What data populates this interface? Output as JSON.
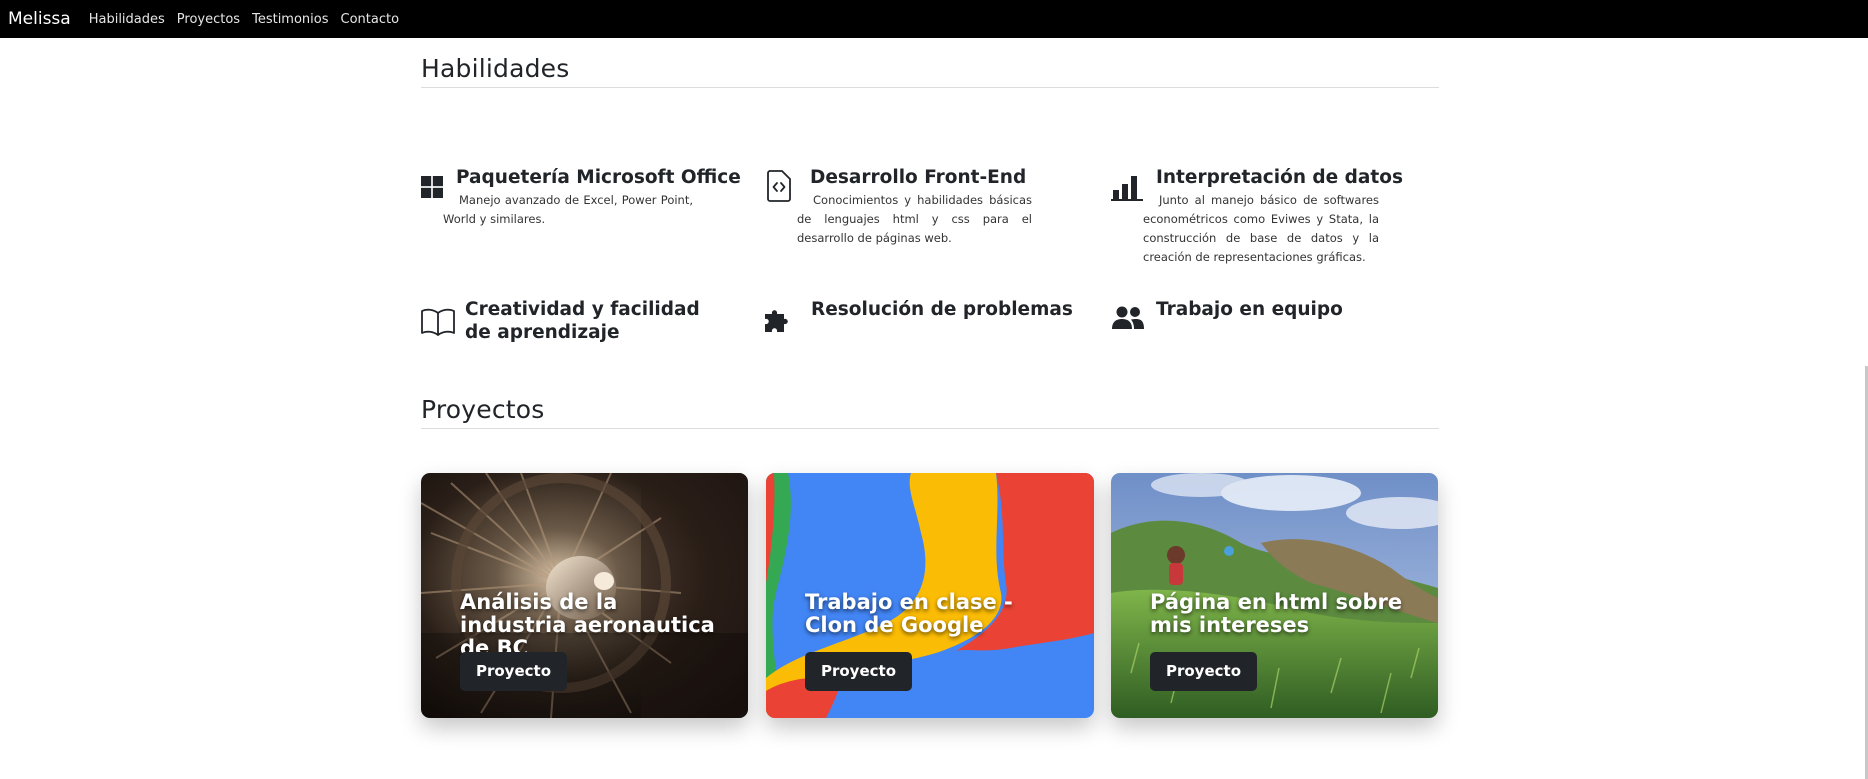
{
  "navbar": {
    "brand": "Melissa",
    "links": [
      "Habilidades",
      "Proyectos",
      "Testimonios",
      "Contacto"
    ]
  },
  "skills": {
    "title": "Habilidades",
    "items": [
      {
        "icon": "windows-icon",
        "title": "Paquetería Microsoft Office",
        "text": "Manejo avanzado de Excel, Power Point, World y similares."
      },
      {
        "icon": "code-file-icon",
        "title": "Desarrollo Front-End",
        "text": "Conocimientos y habilidades básicas de lenguajes html y css para el desarrollo de páginas web."
      },
      {
        "icon": "bar-chart-icon",
        "title": "Interpretación de datos",
        "text": "Junto al manejo básico de softwares econométricos como Eviwes y Stata, la construcción de base de datos y la creación de representaciones gráficas."
      },
      {
        "icon": "book-icon",
        "title": "Creatividad y facilidad de aprendizaje",
        "text": ""
      },
      {
        "icon": "puzzle-icon",
        "title": "Resolución de problemas",
        "text": ""
      },
      {
        "icon": "people-icon",
        "title": "Trabajo en equipo",
        "text": ""
      }
    ]
  },
  "projects": {
    "title": "Proyectos",
    "cards": [
      {
        "title": "Análisis de la industria aeronautica de BC",
        "button": "Proyecto"
      },
      {
        "title": "Trabajo en clase - Clon de Google",
        "button": "Proyecto"
      },
      {
        "title": "Página en html sobre mis intereses",
        "button": "Proyecto"
      }
    ]
  },
  "colors": {
    "navbar": "#000000",
    "button": "#212529",
    "text": "#212529"
  }
}
